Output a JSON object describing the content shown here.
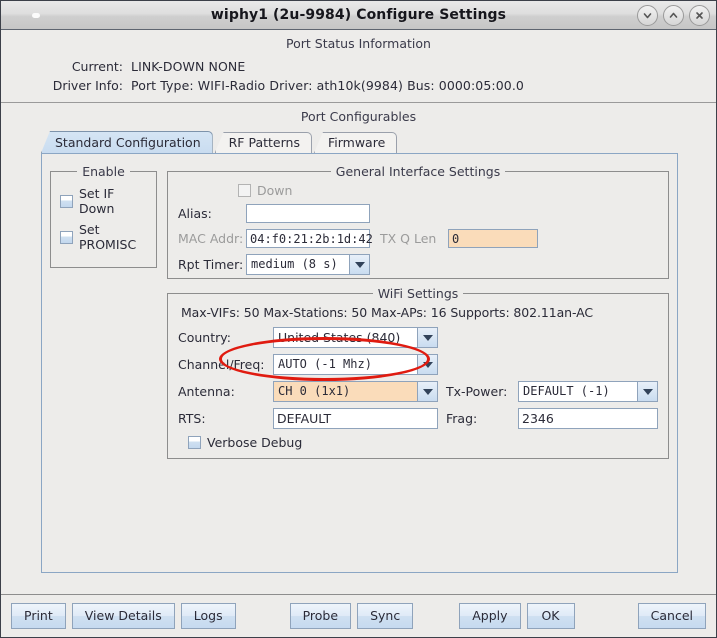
{
  "window": {
    "title": "wiphy1  (2u-9984) Configure Settings",
    "buttons": {
      "minimize": "minimize-icon",
      "maximize": "maximize-icon",
      "close": "close-icon"
    }
  },
  "status": {
    "heading": "Port Status Information",
    "current_label": "Current:",
    "current_value": "LINK-DOWN  NONE",
    "driver_label": "Driver Info:",
    "driver_value": "Port Type: WIFI-Radio   Driver: ath10k(9984)  Bus: 0000:05:00.0"
  },
  "configurables": {
    "heading": "Port Configurables",
    "tabs": [
      {
        "label": "Standard Configuration",
        "selected": true
      },
      {
        "label": "RF Patterns",
        "selected": false
      },
      {
        "label": "Firmware",
        "selected": false
      }
    ]
  },
  "enable_group": {
    "legend": "Enable",
    "items": [
      {
        "label": "Set IF Down",
        "checked": false
      },
      {
        "label": "Set PROMISC",
        "checked": false
      }
    ]
  },
  "general_interface": {
    "legend": "General Interface Settings",
    "down_label": "Down",
    "down_checked": false,
    "alias_label": "Alias:",
    "alias_value": "",
    "alias_placeholder": "",
    "mac_label": "MAC Addr:",
    "mac_value": "04:f0:21:2b:1d:42",
    "txqlen_label": "TX Q Len",
    "txqlen_value": "0",
    "rpt_timer_label": "Rpt Timer:",
    "rpt_timer_value": "medium  (8 s)"
  },
  "wifi_settings": {
    "legend": "WiFi Settings",
    "info": "Max-VIFs: 50  Max-Stations: 50  Max-APs: 16  Supports: 802.11an-AC",
    "country_label": "Country:",
    "country_value": "United States (840)",
    "channel_label": "Channel/Freq:",
    "channel_value": "AUTO (-1 Mhz)",
    "antenna_label": "Antenna:",
    "antenna_value": "CH 0  (1x1)",
    "txpower_label": "Tx-Power:",
    "txpower_value": "DEFAULT  (-1)",
    "rts_label": "RTS:",
    "rts_value": "DEFAULT",
    "frag_label": "Frag:",
    "frag_value": "2346",
    "verbose_label": "Verbose Debug",
    "verbose_checked": false
  },
  "annotation": {
    "shape": "ellipse",
    "color": "#e01b10",
    "target": "antenna-combo"
  },
  "footer": {
    "print": "Print",
    "view_details": "View Details",
    "logs": "Logs",
    "probe": "Probe",
    "sync": "Sync",
    "apply": "Apply",
    "ok": "OK",
    "cancel": "Cancel"
  },
  "colors": {
    "accent": "#c9dcf0",
    "highlight_field": "#fadcba",
    "annotation": "#e01b10"
  }
}
